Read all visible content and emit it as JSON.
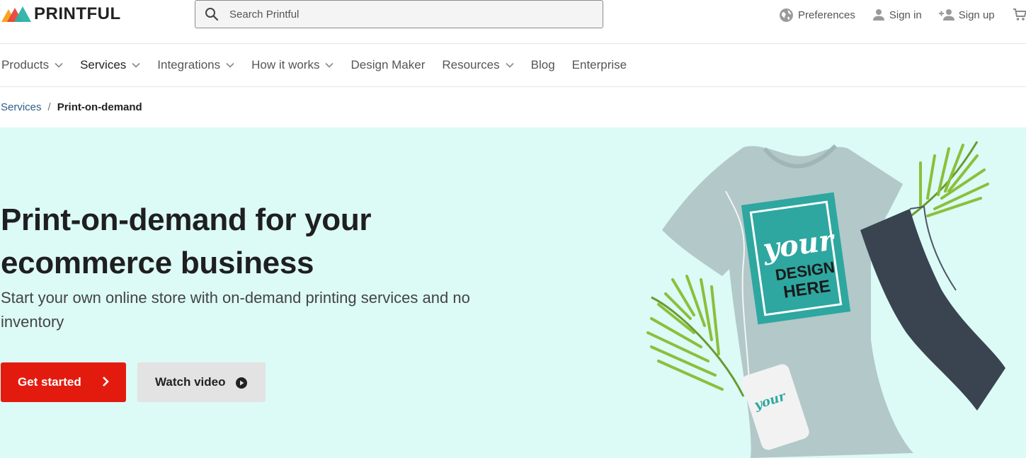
{
  "brand": {
    "name": "PRINTFUL",
    "colors": [
      "#f6a623",
      "#e8463b",
      "#2bb3a6"
    ]
  },
  "search": {
    "placeholder": "Search Printful",
    "icon": "search-icon"
  },
  "top_links": [
    {
      "label": "Preferences",
      "icon": "globe-icon"
    },
    {
      "label": "Sign in",
      "icon": "user-icon"
    },
    {
      "label": "Sign up",
      "icon": "add-user-icon"
    }
  ],
  "cart": {
    "icon": "cart-icon"
  },
  "nav": {
    "items": [
      {
        "label": "Products",
        "has_dropdown": true
      },
      {
        "label": "Services",
        "has_dropdown": true,
        "active": true
      },
      {
        "label": "Integrations",
        "has_dropdown": true
      },
      {
        "label": "How it works",
        "has_dropdown": true
      },
      {
        "label": "Design Maker",
        "has_dropdown": false
      },
      {
        "label": "Resources",
        "has_dropdown": true
      },
      {
        "label": "Blog",
        "has_dropdown": false
      },
      {
        "label": "Enterprise",
        "has_dropdown": false
      }
    ]
  },
  "breadcrumb": {
    "parent": "Services",
    "separator": "/",
    "current": "Print-on-demand"
  },
  "hero": {
    "title_line1": "Print-on-demand for your",
    "title_line2": "ecommerce business",
    "subtitle": "Start your own online store with on-demand printing services and no inventory",
    "primary_button": "Get started",
    "secondary_button": "Watch video",
    "art_text": {
      "line1": "your",
      "line2": "DESIGN",
      "line3": "HERE"
    },
    "colors": {
      "background": "#dcfaf6",
      "primary": "#e31b0f",
      "secondary": "#e3e3e3"
    }
  }
}
